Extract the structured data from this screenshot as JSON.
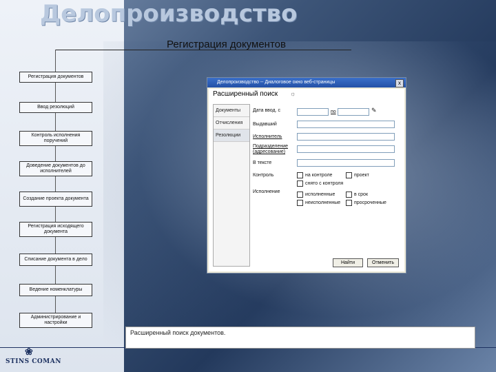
{
  "slide": {
    "title": "Делопроизводство",
    "subtitle": "Регистрация документов",
    "caption": "Расширенный поиск документов.",
    "logo": "STINS COMAN"
  },
  "flow": {
    "items": [
      "Регистрация документов",
      "Ввод резолюций",
      "Контроль исполнения поручений",
      "Доведение документов до исполнителей",
      "Создание проекта документа",
      "Регистрация исходящего документа",
      "Списание документа в дело",
      "Ведение номенклатуры",
      "Администрирование и настройки"
    ]
  },
  "dialog": {
    "window_title": "Делопроизводство -- Диалоговое окно веб-страницы",
    "close_label": "x",
    "heading": "Расширенный поиск",
    "tabs": [
      "Документы",
      "Отчисления",
      "Резолюции"
    ],
    "fields": {
      "date_label": "Дата ввод. с",
      "date_to": "по",
      "author_label": "Выдавший",
      "executor_label": "Исполнитель",
      "sub_executor_label": "Подразделение (адресование)",
      "text_label": "В тексте",
      "control_label": "Контроль",
      "execution_label": "Исполнение"
    },
    "checkboxes": {
      "control": [
        "на контроле",
        "проект",
        "снято с контроля"
      ],
      "execution": [
        "исполненные",
        "в срок",
        "неисполненные",
        "просроченные"
      ]
    },
    "buttons": {
      "find": "Найти",
      "cancel": "Отменить"
    }
  }
}
